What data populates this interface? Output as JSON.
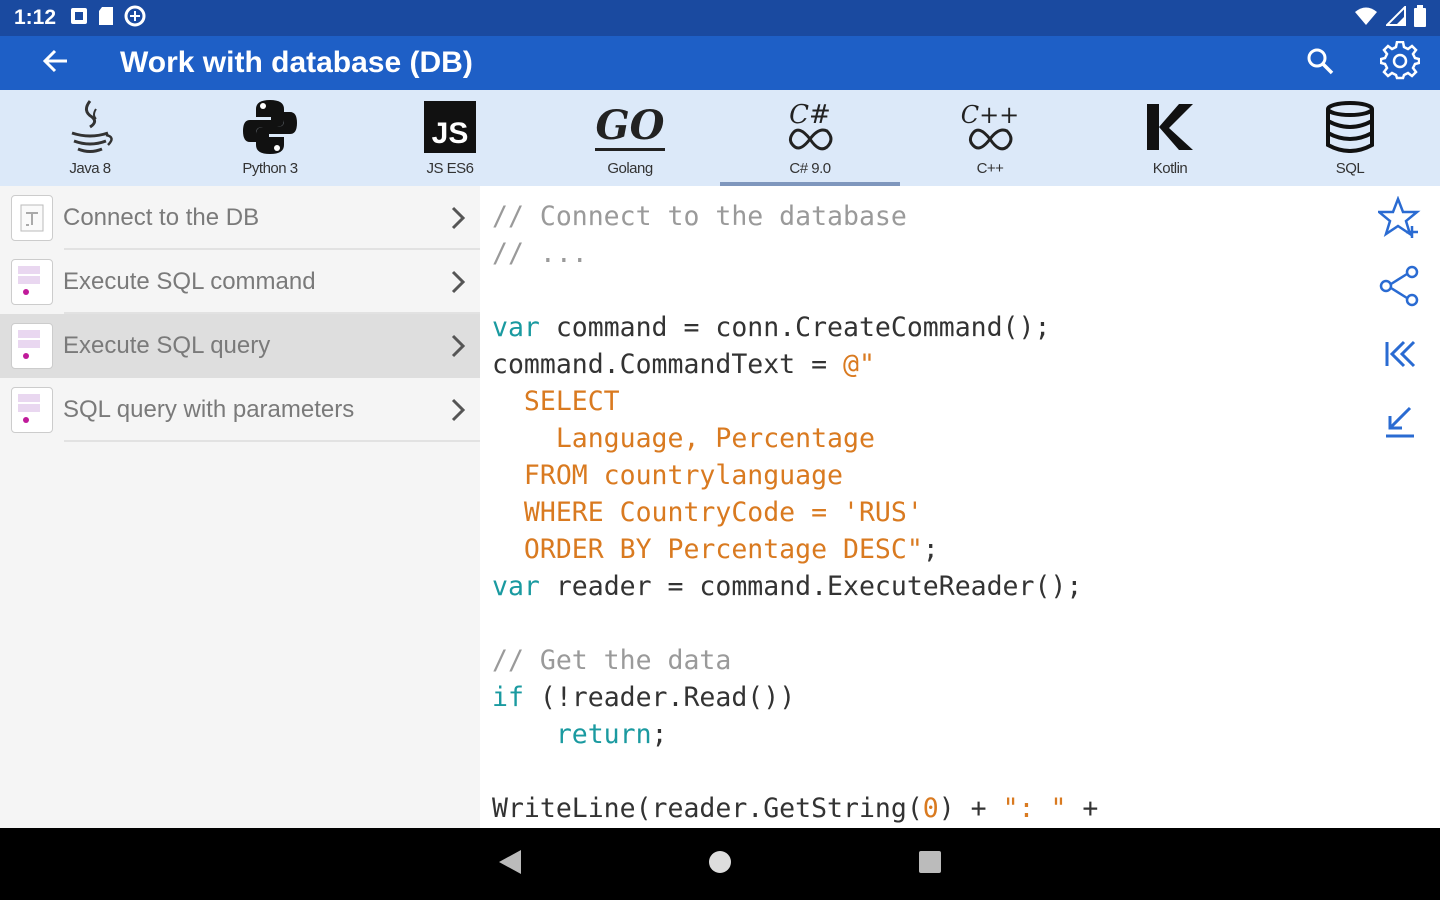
{
  "status": {
    "time": "1:12",
    "icons_left": [
      "notification-icon",
      "sd-card-icon",
      "sync-icon"
    ],
    "icons_right": [
      "wifi-icon",
      "signal-icon",
      "battery-icon"
    ]
  },
  "appbar": {
    "title": "Work with database (DB)",
    "back_icon": "arrow-left-icon",
    "actions": [
      "search-icon",
      "gear-icon"
    ]
  },
  "languages": [
    {
      "label": "Java 8",
      "icon": "java-icon"
    },
    {
      "label": "Python 3",
      "icon": "python-icon"
    },
    {
      "label": "JS ES6",
      "icon": "js-icon",
      "logo_text": "JS"
    },
    {
      "label": "Golang",
      "icon": "go-icon",
      "logo_text": "GO"
    },
    {
      "label": "C# 9.0",
      "icon": "csharp-icon",
      "logo_text": "C#",
      "active": true
    },
    {
      "label": "C++",
      "icon": "cpp-icon",
      "logo_text": "C++"
    },
    {
      "label": "Kotlin",
      "icon": "kotlin-icon"
    },
    {
      "label": "SQL",
      "icon": "database-icon"
    }
  ],
  "sidebar": {
    "items": [
      {
        "label": "Connect to the DB",
        "thumb": "doc-icon"
      },
      {
        "label": "Execute SQL command",
        "thumb": "func-code-icon"
      },
      {
        "label": "Execute SQL query",
        "thumb": "func-code-icon",
        "selected": true
      },
      {
        "label": "SQL query with parameters",
        "thumb": "func-code-icon"
      }
    ]
  },
  "code": {
    "lines": [
      [
        [
          "c",
          "// Connect to the database"
        ]
      ],
      [
        [
          "c",
          "// ..."
        ]
      ],
      [],
      [
        [
          "k",
          "var"
        ],
        [
          "p",
          " command = conn.CreateCommand();"
        ]
      ],
      [
        [
          "p",
          "command.CommandText = "
        ],
        [
          "s",
          "@\""
        ]
      ],
      [
        [
          "s",
          "  SELECT"
        ]
      ],
      [
        [
          "s",
          "    Language, Percentage"
        ]
      ],
      [
        [
          "s",
          "  FROM countrylanguage"
        ]
      ],
      [
        [
          "s",
          "  WHERE CountryCode = 'RUS'"
        ]
      ],
      [
        [
          "s",
          "  ORDER BY Percentage DESC\""
        ],
        [
          "p",
          ";"
        ]
      ],
      [
        [
          "k",
          "var"
        ],
        [
          "p",
          " reader = command.ExecuteReader();"
        ]
      ],
      [],
      [
        [
          "c",
          "// Get the data"
        ]
      ],
      [
        [
          "k",
          "if"
        ],
        [
          "p",
          " (!reader.Read())"
        ]
      ],
      [
        [
          "k",
          "    return"
        ],
        [
          "p",
          ";"
        ]
      ],
      [],
      [
        [
          "p",
          "WriteLine(reader.GetString("
        ],
        [
          "s",
          "0"
        ],
        [
          "p",
          ") + "
        ],
        [
          "s",
          "\": \""
        ],
        [
          "p",
          " +"
        ]
      ]
    ]
  },
  "right_actions": [
    "star-add-icon",
    "share-icon",
    "first-page-icon",
    "scroll-to-end-icon"
  ],
  "navbar": [
    "back-triangle-icon",
    "home-circle-icon",
    "recents-square-icon"
  ]
}
